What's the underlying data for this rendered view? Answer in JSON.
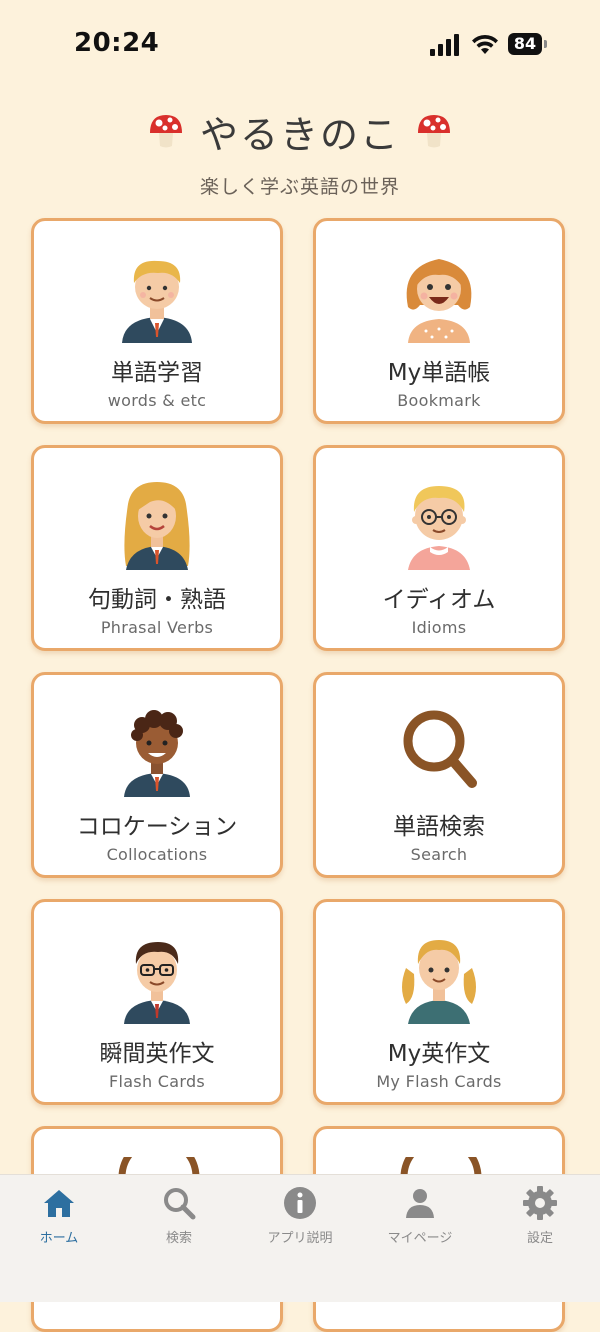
{
  "status_bar": {
    "time": "20:24",
    "battery": "84"
  },
  "header": {
    "title": "やるきのこ",
    "subtitle": "楽しく学ぶ英語の世界"
  },
  "cards": [
    {
      "label": "単語学習",
      "sub": "words & etc",
      "icon": "boy-suit-avatar"
    },
    {
      "label": "My単語帳",
      "sub": "Bookmark",
      "icon": "girl-laughing-avatar"
    },
    {
      "label": "句動詞・熟語",
      "sub": "Phrasal Verbs",
      "icon": "woman-blonde-avatar"
    },
    {
      "label": "イディオム",
      "sub": "Idioms",
      "icon": "boy-glasses-avatar"
    },
    {
      "label": "コロケーション",
      "sub": "Collocations",
      "icon": "man-curly-avatar"
    },
    {
      "label": "単語検索",
      "sub": "Search",
      "icon": "magnifier-icon"
    },
    {
      "label": "瞬間英作文",
      "sub": "Flash Cards",
      "icon": "man-glasses-avatar"
    },
    {
      "label": "My英作文",
      "sub": "My Flash Cards",
      "icon": "girl-pigtails-avatar"
    }
  ],
  "tabs": [
    {
      "label": "ホーム",
      "icon": "home-icon",
      "active": true
    },
    {
      "label": "検索",
      "icon": "search-icon"
    },
    {
      "label": "アプリ説明",
      "icon": "info-icon"
    },
    {
      "label": "マイページ",
      "icon": "person-icon"
    },
    {
      "label": "設定",
      "icon": "gear-icon"
    }
  ],
  "colors": {
    "background": "#fdf2dc",
    "card_border": "#e9a86a",
    "active_tab": "#2d6fa0",
    "inactive_tab": "#8a8a8a"
  }
}
